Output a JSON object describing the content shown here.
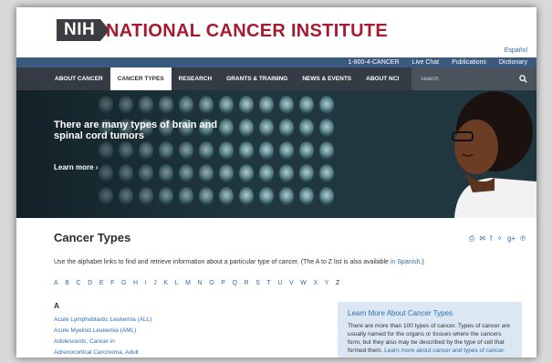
{
  "header": {
    "logo_badge": "NIH",
    "logo_text": "NATIONAL CANCER INSTITUTE",
    "language_link": "Español"
  },
  "utility_nav": [
    "1-800-4-CANCER",
    "Live Chat",
    "Publications",
    "Dictionary"
  ],
  "main_nav": {
    "items": [
      "ABOUT CANCER",
      "CANCER TYPES",
      "RESEARCH",
      "GRANTS & TRAINING",
      "NEWS & EVENTS",
      "ABOUT NCI"
    ],
    "active": "CANCER TYPES",
    "search_placeholder": "search"
  },
  "hero": {
    "headline": "There are many types of brain and spinal cord tumors",
    "link": "Learn more ›"
  },
  "main": {
    "title": "Cancer Types",
    "intro": "Use the alphabet links to find and retrieve information about a particular type of cancer. (The A to Z list is also available ",
    "intro_link": "in Spanish",
    "intro_end": ".)",
    "alphabet": [
      "A",
      "B",
      "C",
      "D",
      "E",
      "F",
      "G",
      "H",
      "I",
      "J",
      "K",
      "L",
      "M",
      "N",
      "O",
      "P",
      "Q",
      "R",
      "S",
      "T",
      "U",
      "V",
      "W",
      "X",
      "Y",
      "Z"
    ],
    "section_letter": "A",
    "types": [
      "Acute Lymphoblastic Leukemia (ALL)",
      "Acute Myeloid Leukemia (AML)",
      "Adolescents, Cancer in",
      "Adrenocortical Carcinoma, Adult"
    ]
  },
  "sidebar_box": {
    "title": "Learn More About Cancer Types",
    "text": "There are more than 100 types of cancer. Types of cancer are usually named for the organs or tissues where the cancers form, but they also may be described by the type of cell that formed them.",
    "link": "Learn more about cancer and types of cancer."
  },
  "share_icons": [
    "print-icon",
    "email-icon",
    "facebook-icon",
    "twitter-icon",
    "google-plus-icon",
    "pinterest-icon"
  ],
  "colors": {
    "brand_red": "#a51c30",
    "utility_blue": "#3b5a7f",
    "nav_dark": "#343b44",
    "link_blue": "#2f6fad",
    "info_box": "#dbe8f3"
  }
}
